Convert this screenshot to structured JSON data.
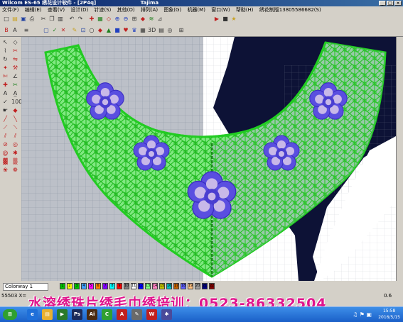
{
  "window": {
    "title": "Wilcom ES-65 绣花设计软件 - [2P4q]",
    "title_extra": "Tajima",
    "buttons": [
      "_",
      "□",
      "×"
    ]
  },
  "menu": {
    "items": [
      "文件(F)",
      "编辑(E)",
      "查看(V)",
      "设计(D)",
      "针迹(S)",
      "其他(O)",
      "排列(A)",
      "图象(G)",
      "机器(M)",
      "窗口(W)",
      "帮助(H)"
    ],
    "phone": "绣花制版13805586682(S)"
  },
  "colorway": {
    "label": "Colorway 1",
    "swatches": [
      {
        "n": "1",
        "color": "#00c000"
      },
      {
        "n": "2",
        "color": "#ffff00"
      },
      {
        "n": "3",
        "color": "#00c000"
      },
      {
        "n": "4",
        "color": "#40a0ff"
      },
      {
        "n": "5",
        "color": "#ff00ff"
      },
      {
        "n": "6",
        "color": "#ff8000"
      },
      {
        "n": "7",
        "color": "#8000ff"
      },
      {
        "n": "8",
        "color": "#00ffff"
      },
      {
        "n": "9",
        "color": "#ff0000"
      },
      {
        "n": "10",
        "color": "#808080"
      },
      {
        "n": "11",
        "color": "#ffffff"
      },
      {
        "n": "12",
        "color": "#0000ff"
      },
      {
        "n": "13",
        "color": "#80ff80"
      },
      {
        "n": "14",
        "color": "#ff80c0"
      },
      {
        "n": "15",
        "color": "#c0c000"
      },
      {
        "n": "16",
        "color": "#00c0c0"
      },
      {
        "n": "17",
        "color": "#c06000"
      },
      {
        "n": "18",
        "color": "#6060ff"
      },
      {
        "n": "19",
        "color": "#ffc080"
      },
      {
        "n": "20",
        "color": "#a0a0a0"
      },
      {
        "n": "21",
        "color": "#000080"
      },
      {
        "n": "22",
        "color": "#800000"
      }
    ]
  },
  "status": {
    "coords": "55503 X=",
    "zoom": "0.6"
  },
  "watermark": "水溶绣珠片绣毛巾绣培训：0523-86332504",
  "taskbar": {
    "time": "15:58",
    "date": "2016/5/15",
    "apps": [
      {
        "icon": "ie-icon",
        "label": "e",
        "color": "#1e6fd9"
      },
      {
        "icon": "folder-icon",
        "label": "▤",
        "color": "#e8b030"
      },
      {
        "icon": "media-icon",
        "label": "▶",
        "color": "#2a7a2a"
      },
      {
        "icon": "photoshop-icon",
        "label": "Ps",
        "color": "#1b2a5a"
      },
      {
        "icon": "illustrator-icon",
        "label": "Ai",
        "color": "#4a2a10"
      },
      {
        "icon": "coreldraw-icon",
        "label": "C",
        "color": "#30a030"
      },
      {
        "icon": "acrobat-icon",
        "label": "A",
        "color": "#c02020"
      },
      {
        "icon": "paint-icon",
        "label": "✎",
        "color": "#6a6a6a"
      },
      {
        "icon": "wilcom-icon",
        "label": "W",
        "color": "#c02020"
      },
      {
        "icon": "sketch-icon",
        "label": "✱",
        "color": "#4a4a9a"
      }
    ]
  },
  "colors": {
    "embroidery_green": "#33dd33",
    "flower_blue": "#5a4ee0",
    "flower_center": "#c8b8e8",
    "dark_fabric": "#0d1236",
    "grid_bg": "#bcc0c8",
    "watermark": "#e0148c"
  }
}
